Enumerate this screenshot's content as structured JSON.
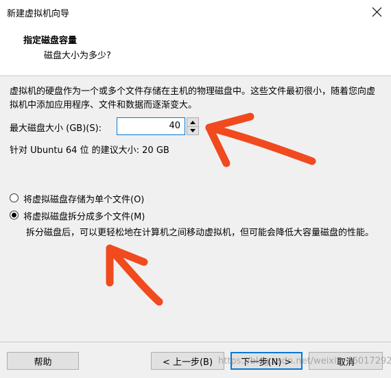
{
  "window": {
    "title": "新建虚拟机向导",
    "close_icon": "close-icon"
  },
  "header": {
    "title": "指定磁盘容量",
    "subtitle": "磁盘大小为多少?"
  },
  "description": "虚拟机的硬盘作为一个或多个文件存储在主机的物理磁盘中。这些文件最初很小，随着您向虚拟机中添加应用程序、文件和数据而逐渐变大。",
  "disk_size": {
    "label": "最大磁盘大小 (GB)(S):",
    "value": "40",
    "recommend": "针对 Ubuntu 64 位 的建议大小: 20 GB"
  },
  "options": {
    "single": {
      "label": "将虚拟磁盘存储为单个文件(O)",
      "selected": false
    },
    "split": {
      "label": "将虚拟磁盘拆分成多个文件(M)",
      "selected": true
    },
    "split_desc": "拆分磁盘后，可以更轻松地在计算机之间移动虚拟机，但可能会降低大容量磁盘的性能。"
  },
  "buttons": {
    "help": "帮助",
    "back": "< 上一步(B)",
    "next": "下一步(N) >",
    "cancel": "取消"
  },
  "watermark": "https://blog.csdn.net/weixin_46017292",
  "colors": {
    "annotation_arrow": "#f04a1e",
    "focus": "#0078d7"
  }
}
